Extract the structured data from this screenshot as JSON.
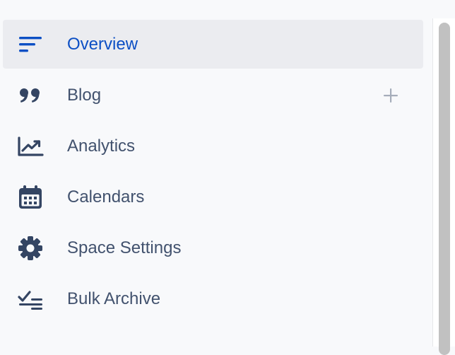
{
  "sidebar": {
    "items": [
      {
        "label": "Overview",
        "icon": "overview-lines-icon",
        "active": true
      },
      {
        "label": "Blog",
        "icon": "quote-icon",
        "active": false
      },
      {
        "label": "Analytics",
        "icon": "line-chart-icon",
        "active": false
      },
      {
        "label": "Calendars",
        "icon": "calendar-icon",
        "active": false
      },
      {
        "label": "Space Settings",
        "icon": "gear-icon",
        "active": false
      },
      {
        "label": "Bulk Archive",
        "icon": "checklist-icon",
        "active": false
      }
    ]
  },
  "colors": {
    "active_text": "#0c4fc4",
    "text": "#42526e",
    "active_bg": "#ebecf0",
    "background": "#f8f9fb",
    "plus": "#a5adba"
  }
}
